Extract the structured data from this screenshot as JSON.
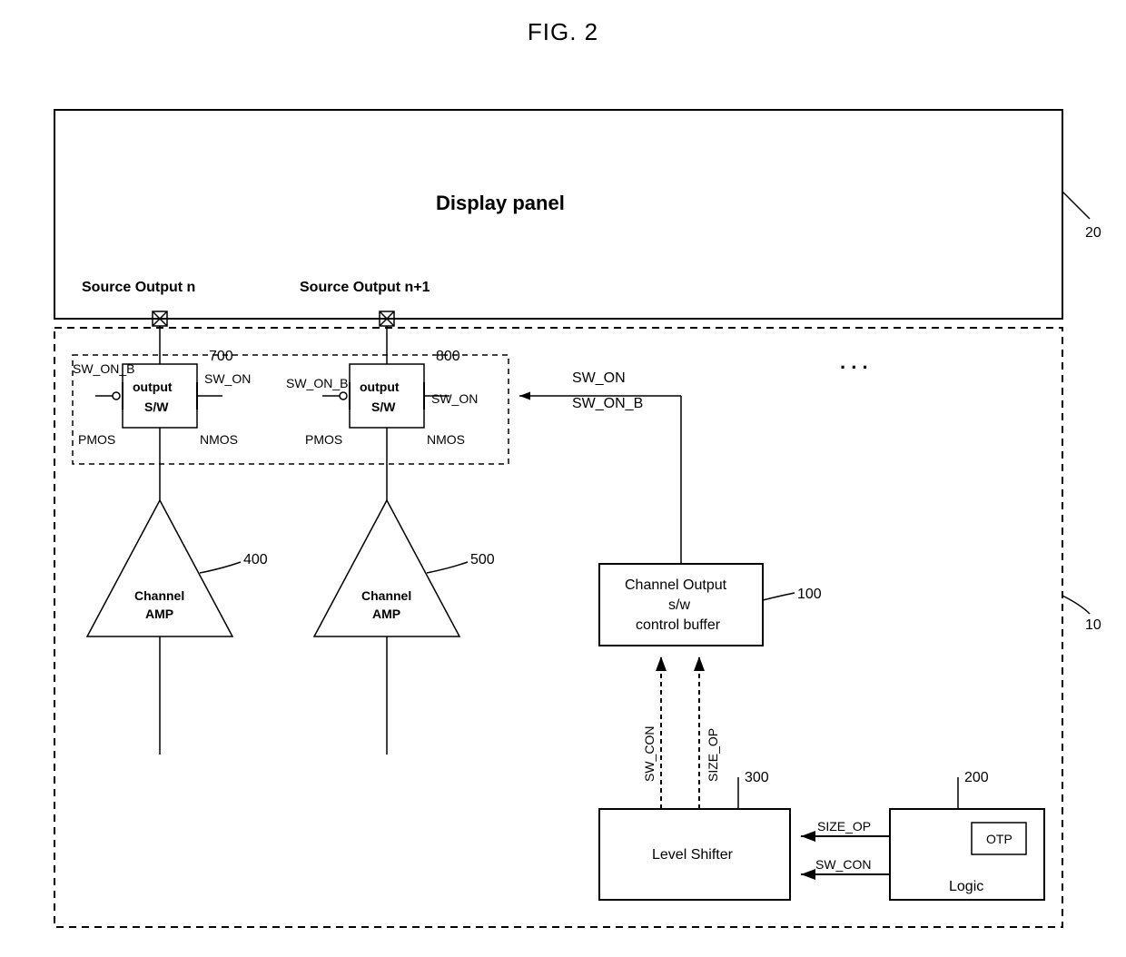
{
  "title": "FIG. 2",
  "display_panel": {
    "label": "Display panel",
    "ref": "20"
  },
  "source_out_n": "Source Output n",
  "source_out_n1": "Source Output n+1",
  "sw_block_700": {
    "ref": "700",
    "sw_on_b": "SW_ON_B",
    "sw_on": "SW_ON",
    "pmos": "PMOS",
    "nmos": "NMOS",
    "label1": "output",
    "label2": "S/W"
  },
  "sw_block_800": {
    "ref": "800",
    "sw_on_b": "SW_ON_B",
    "sw_on": "SW_ON",
    "pmos": "PMOS",
    "nmos": "NMOS",
    "label1": "output",
    "label2": "S/W"
  },
  "amp_400": {
    "label1": "Channel",
    "label2": "AMP",
    "ref": "400"
  },
  "amp_500": {
    "label1": "Channel",
    "label2": "AMP",
    "ref": "500"
  },
  "buffer_100": {
    "l1": "Channel Output",
    "l2": "s/w",
    "l3": "control buffer",
    "ref": "100"
  },
  "signals_to_sw": {
    "sw_on": "SW_ON",
    "sw_on_b": "SW_ON_B"
  },
  "ls_signals": {
    "sw_con": "SW_CON",
    "size_op": "SIZE_OP"
  },
  "level_shifter": {
    "label": "Level Shifter",
    "ref": "300"
  },
  "logic_block": {
    "label": "Logic",
    "otp": "OTP",
    "ref": "200"
  },
  "logic_to_ls": {
    "size_op": "SIZE_OP",
    "sw_con": "SW_CON"
  },
  "chip_ref": "10",
  "ellipsis": ". . ."
}
